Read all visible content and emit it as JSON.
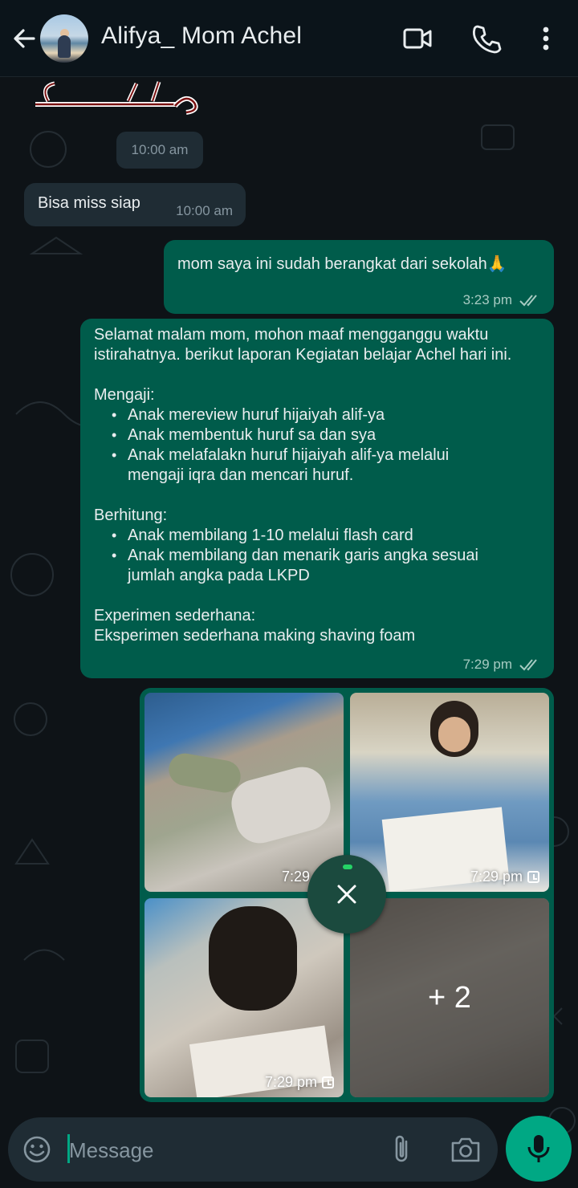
{
  "header": {
    "contact_name": "Alifya_ Mom Achel"
  },
  "messages": {
    "arabic_fragment": "وَبَرَكَاتُهُ",
    "time_chip": "10:00 am",
    "m1": {
      "text": "Bisa miss siap",
      "time": "10:00 am"
    },
    "m2": {
      "text": "mom saya ini sudah berangkat dari sekolah🙏",
      "time": "3:23 pm"
    },
    "m3": {
      "intro": "Selamat malam mom, mohon maaf mengganggu waktu istirahatnya.  berikut laporan Kegiatan belajar Achel hari ini.",
      "section1_title": "Mengaji:",
      "section1_items": [
        "Anak mereview huruf hijaiyah alif-ya",
        "Anak membentuk huruf sa dan sya",
        "Anak melafalakn huruf hijaiyah alif-ya melalui mengaji iqra dan mencari huruf."
      ],
      "section2_title": "Berhitung:",
      "section2_items": [
        "Anak membilang 1-10 melalui flash card",
        "Anak membilang dan menarik garis angka sesuai jumlah angka pada LKPD"
      ],
      "section3_title": "Experimen sederhana:",
      "section3_text": "Eksperimen sederhana making shaving foam",
      "time": "7:29 pm"
    },
    "album": {
      "photo1_time": "7:29 pm",
      "photo2_time": "7:29 pm",
      "photo3_time": "7:29 pm",
      "more_count": "+ 2"
    }
  },
  "input": {
    "placeholder": "Message"
  },
  "colors": {
    "outgoing_bubble": "#005c4b",
    "incoming_bubble": "#1f2c34",
    "accent": "#00a884"
  }
}
